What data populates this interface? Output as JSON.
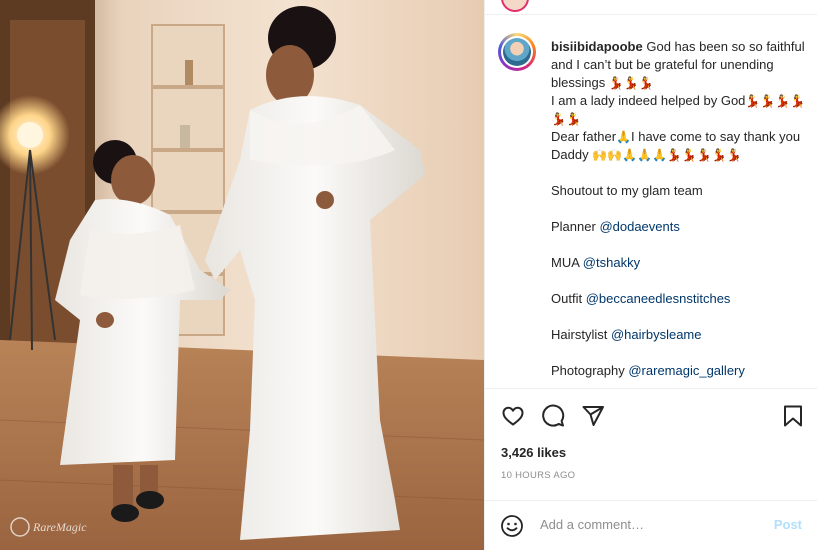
{
  "post": {
    "image_alt": "Woman and little girl in matching white lace dresses",
    "watermark": "RareMagic"
  },
  "caption": {
    "username": "bisiibidapoobe",
    "line1_text": " God has been so so faithful and I can’t but be grateful for unending blessings ",
    "line1_emoji": "💃💃💃",
    "line2_text": "I am a lady indeed helped by God",
    "line2_emoji": "💃💃💃💃💃💃",
    "line3_text": "Dear father",
    "line3_emoji_a": "🙏",
    "line3_text_b": "I have come to say thank you Daddy ",
    "line3_emoji_b": "🙌🙌🙏🙏🙏💃💃💃💃💃",
    "shoutout": "Shoutout to my glam team",
    "credits": [
      {
        "label": "Planner",
        "mention": "@dodaevents"
      },
      {
        "label": "MUA",
        "mention": "@tshakky"
      },
      {
        "label": "Outfit",
        "mention": "@beccaneedlesnstitches"
      },
      {
        "label": "Hairstylist",
        "mention": "@hairbysleame"
      },
      {
        "label": "Photography",
        "mention": "@raremagic_gallery"
      }
    ]
  },
  "actions": {
    "like_icon": "heart-icon",
    "comment_icon": "comment-icon",
    "share_icon": "paper-plane-icon",
    "save_icon": "bookmark-icon",
    "likes": "3,426 likes",
    "time": "10 HOURS AGO"
  },
  "comment": {
    "emoji_icon": "smiley-icon",
    "placeholder": "Add a comment…",
    "post_label": "Post"
  },
  "colors": {
    "mention": "#00376b",
    "post_disabled": "#b2dffc",
    "text": "#262626",
    "muted": "#8e8e8e"
  }
}
